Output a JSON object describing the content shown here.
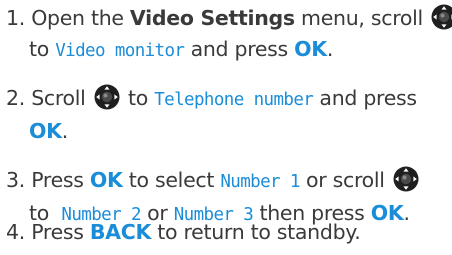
{
  "step1": {
    "num": "1.",
    "t1": "Open the ",
    "menu": "Video Settings",
    "t2": " menu, scroll",
    "t3": "to ",
    "item": "Video monitor",
    "t4": " and press ",
    "ok": "OK",
    "t5": "."
  },
  "step2": {
    "num": "2.",
    "t1": "Scroll",
    "t2": " to ",
    "item": "Telephone number",
    "t3": " and press",
    "ok": "OK",
    "t4": "."
  },
  "step3": {
    "num": "3.",
    "t1": "Press ",
    "ok1": "OK",
    "t2": " to select ",
    "item1": "Number 1",
    "t3": " or scroll",
    "t4": "to  ",
    "item2": "Number 2",
    "t5": " or ",
    "item3": "Number 3",
    "t6": " then press ",
    "ok2": "OK",
    "t7": "."
  },
  "step4": {
    "num": "4.",
    "t1": "Press ",
    "back": "BACK",
    "t2": " to return to standby."
  },
  "colors": {
    "accent": "#1b8dd8",
    "text": "#3a3a3a",
    "navkey": "#1f1f1f"
  },
  "icons": {
    "scroll": "navigation-key-icon"
  }
}
